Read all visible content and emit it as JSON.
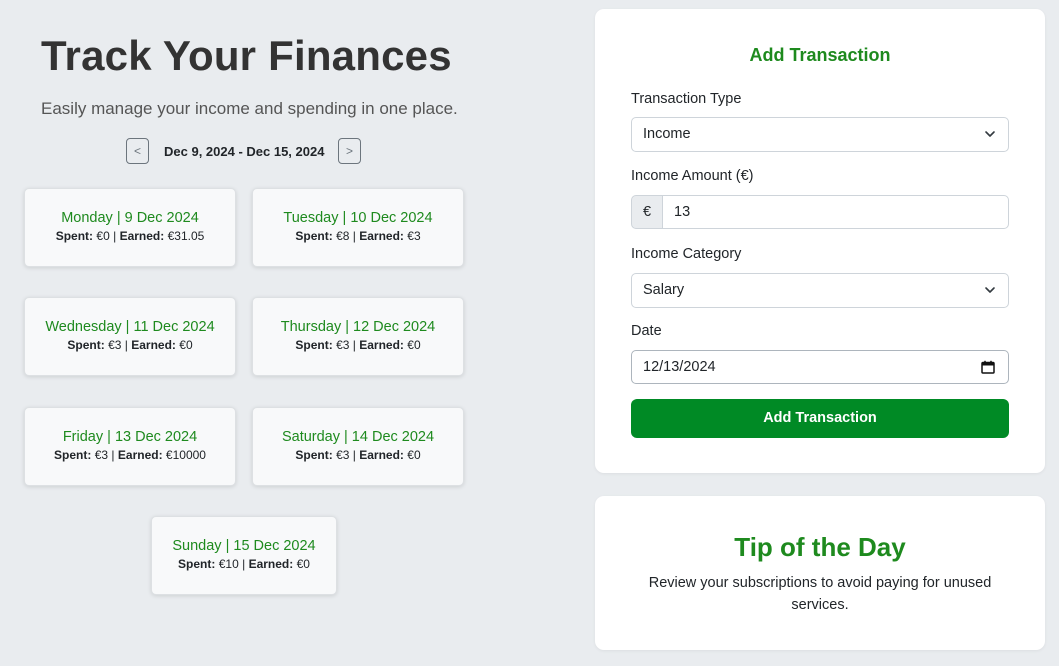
{
  "hero": {
    "title": "Track Your Finances",
    "subtitle": "Easily manage your income and spending in one place."
  },
  "week_nav": {
    "prev_label": "<",
    "next_label": ">",
    "range": "Dec 9, 2024 - Dec 15, 2024"
  },
  "stats_labels": {
    "spent": "Spent:",
    "earned": "Earned:",
    "separator": "|"
  },
  "days": [
    {
      "title": "Monday | 9 Dec 2024",
      "spent": "€0",
      "earned": "€31.05"
    },
    {
      "title": "Tuesday | 10 Dec 2024",
      "spent": "€8",
      "earned": "€3"
    },
    {
      "title": "Wednesday | 11 Dec 2024",
      "spent": "€3",
      "earned": "€0"
    },
    {
      "title": "Thursday | 12 Dec 2024",
      "spent": "€3",
      "earned": "€0"
    },
    {
      "title": "Friday | 13 Dec 2024",
      "spent": "€3",
      "earned": "€10000"
    },
    {
      "title": "Saturday | 14 Dec 2024",
      "spent": "€3",
      "earned": "€0"
    },
    {
      "title": "Sunday | 15 Dec 2024",
      "spent": "€10",
      "earned": "€0"
    }
  ],
  "form": {
    "title": "Add Transaction",
    "type_label": "Transaction Type",
    "type_value": "Income",
    "amount_label": "Income Amount (€)",
    "amount_prefix": "€",
    "amount_value": "13",
    "category_label": "Income Category",
    "category_value": "Salary",
    "date_label": "Date",
    "date_value": "12/13/2024",
    "submit_label": "Add Transaction"
  },
  "tip": {
    "title": "Tip of the Day",
    "text": "Review your subscriptions to avoid paying for unused services."
  },
  "colors": {
    "accent_green": "#1e8a1e",
    "button_green": "#008a25",
    "background": "#e9ecef"
  },
  "icons": {
    "select_chevron": "chevron-down-icon",
    "date_picker": "calendar-icon"
  }
}
